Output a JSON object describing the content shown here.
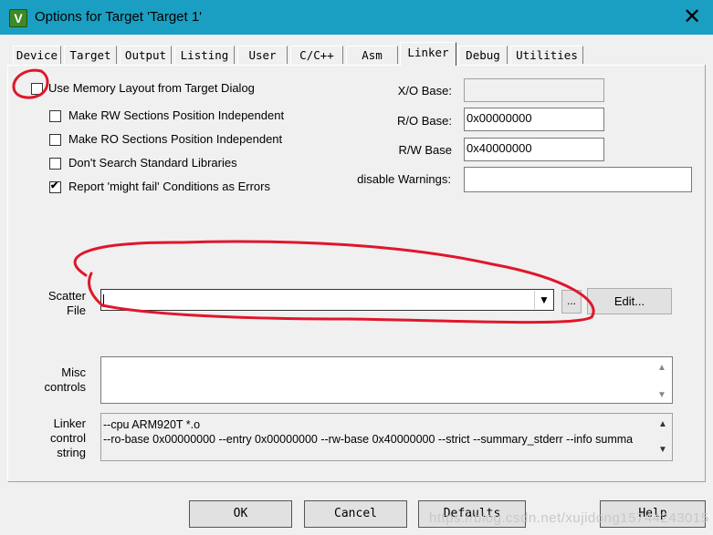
{
  "window": {
    "title": "Options for Target 'Target 1'",
    "close_glyph": "✕",
    "icon_letter": "V"
  },
  "tabs": [
    {
      "label": "Device"
    },
    {
      "label": "Target"
    },
    {
      "label": "Output"
    },
    {
      "label": "Listing"
    },
    {
      "label": "User"
    },
    {
      "label": "C/C++"
    },
    {
      "label": "Asm"
    },
    {
      "label": "Linker",
      "active": true
    },
    {
      "label": "Debug"
    },
    {
      "label": "Utilities"
    }
  ],
  "options": [
    {
      "label": "Use Memory Layout from Target Dialog",
      "checked": false
    },
    {
      "label": "Make RW Sections Position Independent",
      "checked": false
    },
    {
      "label": "Make RO Sections Position Independent",
      "checked": false
    },
    {
      "label": "Don't Search Standard Libraries",
      "checked": false
    },
    {
      "label": "Report 'might fail' Conditions as Errors",
      "checked": true
    }
  ],
  "bases": {
    "xo_label": "X/O Base:",
    "xo_value": "",
    "ro_label": "R/O Base:",
    "ro_value": "0x00000000",
    "rw_label": "R/W Base",
    "rw_value": "0x40000000",
    "warn_label": "disable Warnings:",
    "warn_value": ""
  },
  "scatter": {
    "label_line1": "Scatter",
    "label_line2": "File",
    "value": "",
    "browse_label": "...",
    "edit_label": "Edit..."
  },
  "misc": {
    "label_line1": "Misc",
    "label_line2": "controls",
    "value": ""
  },
  "linker": {
    "label_line1": "Linker",
    "label_line2": "control",
    "label_line3": "string",
    "line1": "--cpu ARM920T *.o",
    "line2": "--ro-base 0x00000000 --entry 0x00000000 --rw-base 0x40000000 --strict --summary_stderr --info summa"
  },
  "buttons": {
    "ok": "OK",
    "cancel": "Cancel",
    "defaults": "Defaults",
    "help": "Help"
  },
  "watermark": "https://blog.csdn.net/xujidong15744243015",
  "colors": {
    "titlebar": "#1a9fc2",
    "annotation": "#e0162b"
  }
}
